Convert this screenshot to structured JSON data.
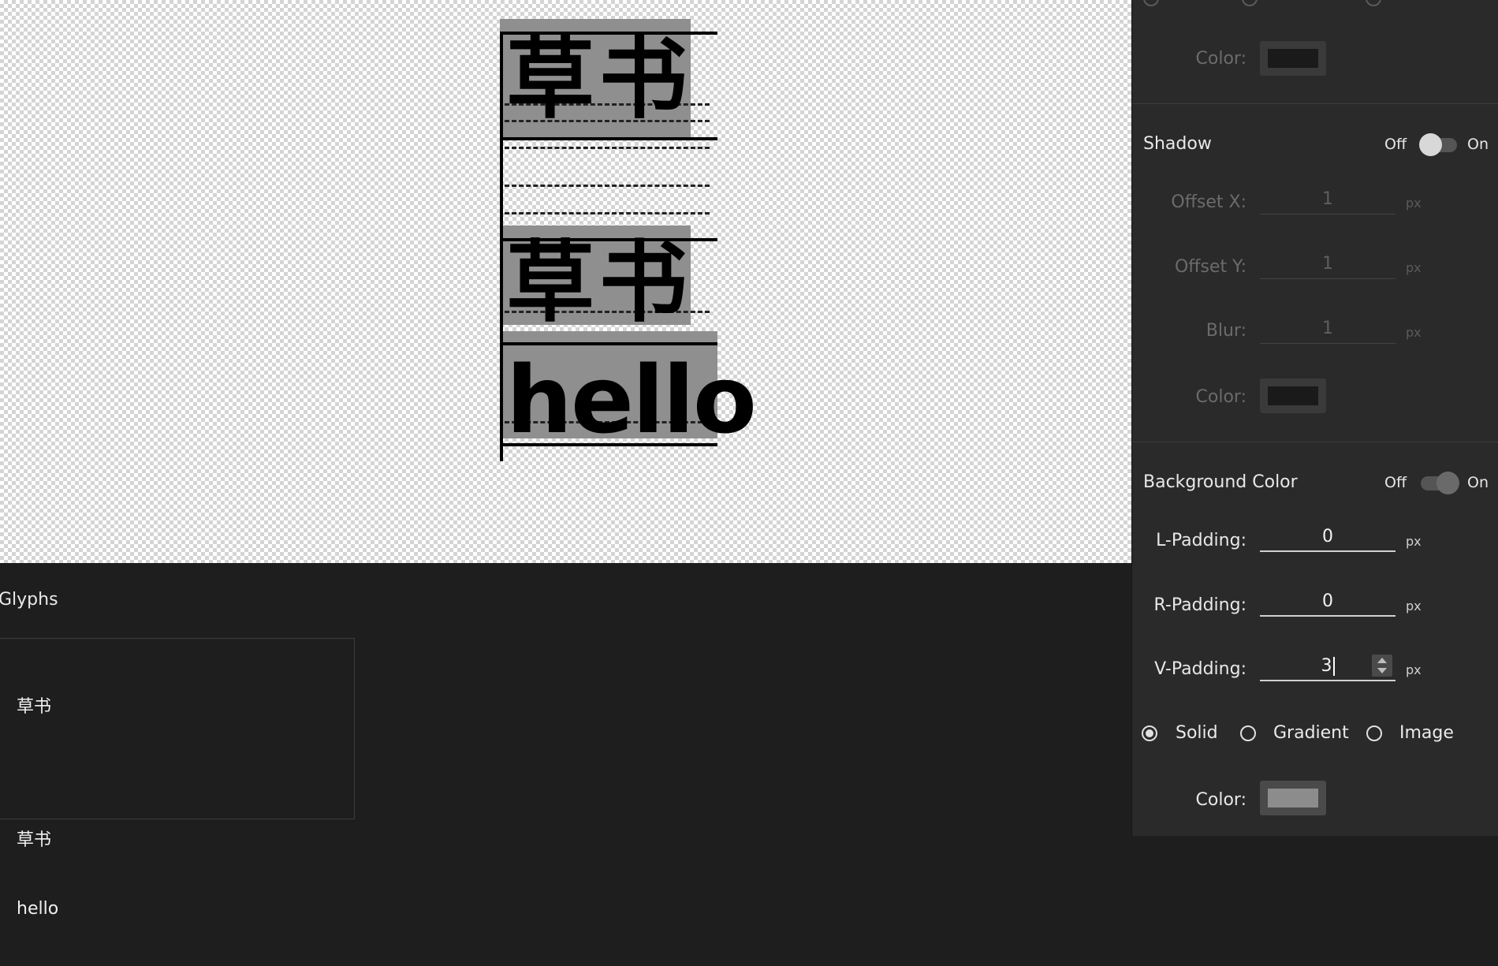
{
  "preview": {
    "glyph_rows": [
      {
        "text": "草书",
        "kind": "cjk"
      },
      {
        "text": "草书",
        "kind": "cjk"
      },
      {
        "text": "hello",
        "kind": "latin"
      }
    ]
  },
  "glyphs_panel": {
    "title": "Glyphs",
    "lines": [
      "草书",
      "",
      "草书",
      "hello"
    ]
  },
  "inspector": {
    "outline": {
      "color_label": "Color:",
      "color": "#1a1a1a"
    },
    "shadow": {
      "title": "Shadow",
      "off_label": "Off",
      "on_label": "On",
      "enabled": false,
      "offset_x_label": "Offset X:",
      "offset_x": "1",
      "offset_y_label": "Offset Y:",
      "offset_y": "1",
      "blur_label": "Blur:",
      "blur": "1",
      "unit": "px",
      "color_label": "Color:",
      "color": "#1a1a1a"
    },
    "background": {
      "title": "Background Color",
      "off_label": "Off",
      "on_label": "On",
      "enabled": true,
      "l_padding_label": "L-Padding:",
      "l_padding": "0",
      "r_padding_label": "R-Padding:",
      "r_padding": "0",
      "v_padding_label": "V-Padding:",
      "v_padding": "3",
      "unit": "px",
      "fill_options": [
        "Solid",
        "Gradient",
        "Image"
      ],
      "selected_fill": "Solid",
      "color_label": "Color:",
      "color": "#8c8c8c"
    }
  }
}
